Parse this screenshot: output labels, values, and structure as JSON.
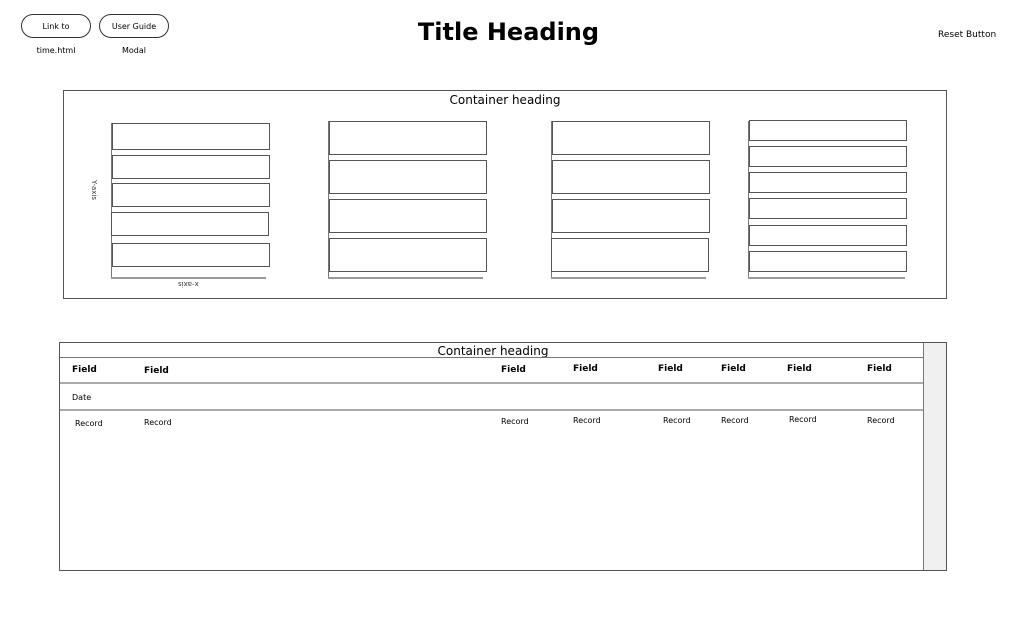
{
  "header": {
    "link_button": "Link to time.html",
    "guide_button": "User Guide Modal",
    "title": "Title Heading",
    "reset_button": "Reset Button"
  },
  "chart_panel": {
    "heading": "Container heading",
    "y_axis_label": "Y-axis",
    "x_axis_label": "x-axis"
  },
  "table_panel": {
    "heading": "Container heading",
    "columns": [
      "Field",
      "Field",
      "Field",
      "Field",
      "Field",
      "Field",
      "Field",
      "Field"
    ],
    "group_label": "Date",
    "rows": [
      [
        "Record",
        "Record",
        "Record",
        "Record",
        "Record",
        "Record",
        "Record",
        "Record"
      ]
    ]
  }
}
